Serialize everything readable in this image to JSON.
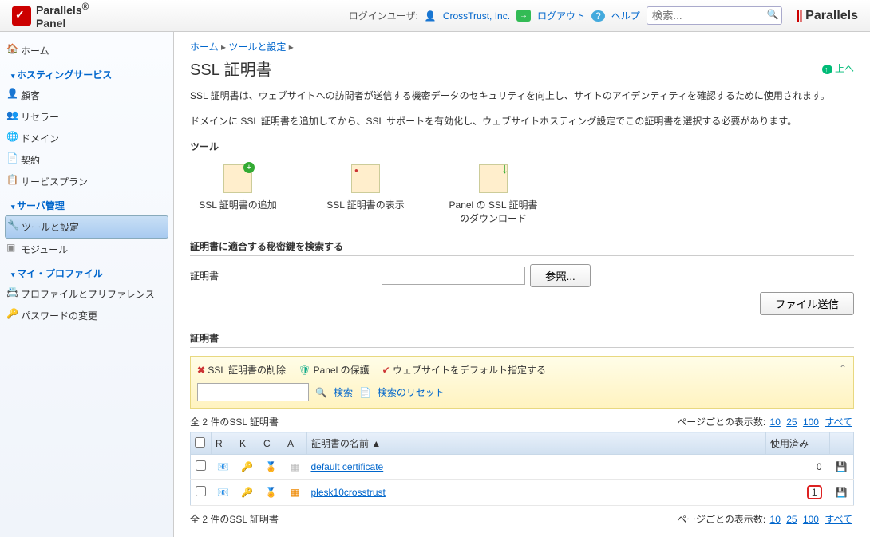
{
  "brand": "Parallels",
  "brand_sub": "Panel",
  "header": {
    "login_user_label": "ログインユーザ:",
    "user": "CrossTrust, Inc.",
    "logout": "ログアウト",
    "help": "ヘルプ",
    "search_placeholder": "検索..."
  },
  "sidebar": {
    "home": "ホーム",
    "hosting_group": "ホスティングサービス",
    "hosting": {
      "customers": "顧客",
      "resellers": "リセラー",
      "domains": "ドメイン",
      "contracts": "契約",
      "plans": "サービスプラン"
    },
    "server_group": "サーバ管理",
    "server": {
      "tools": "ツールと設定",
      "modules": "モジュール"
    },
    "profile_group": "マイ・プロファイル",
    "profile": {
      "prefs": "プロファイルとプリファレンス",
      "password": "パスワードの変更"
    }
  },
  "breadcrumb": {
    "home": "ホーム",
    "tools": "ツールと設定"
  },
  "page": {
    "title": "SSL 証明書",
    "up": "上へ",
    "desc1": "SSL 証明書は、ウェブサイトへの訪問者が送信する機密データのセキュリティを向上し、サイトのアイデンティティを確認するために使用されます。",
    "desc2": "ドメインに SSL 証明書を追加してから、SSL サポートを有効化し、ウェブサイトホスティング設定でこの証明書を選択する必要があります。"
  },
  "tools": {
    "heading": "ツール",
    "add": "SSL 証明書の追加",
    "view": "SSL 証明書の表示",
    "download": "Panel の SSL 証明書のダウンロード"
  },
  "find": {
    "heading": "証明書に適合する秘密鍵を検索する",
    "label": "証明書",
    "browse": "参照...",
    "submit": "ファイル送信"
  },
  "certs": {
    "heading": "証明書",
    "delete": "SSL 証明書の削除",
    "protect": "Panel の保護",
    "default": "ウェブサイトをデフォルト指定する",
    "search": "検索",
    "reset": "検索のリセット",
    "count_text": "全 2 件のSSL 証明書",
    "per_page_label": "ページごとの表示数:",
    "per_page": [
      "10",
      "25",
      "100",
      "すべて"
    ],
    "cols": {
      "r": "R",
      "k": "K",
      "c": "C",
      "a": "A",
      "name": "証明書の名前 ▲",
      "used": "使用済み"
    },
    "rows": [
      {
        "name": "default certificate",
        "used": "0",
        "r": "gray",
        "a": "gray"
      },
      {
        "name": "plesk10crosstrust",
        "used": "1",
        "r": "orange",
        "a": "orange",
        "highlight_used": true
      }
    ]
  }
}
